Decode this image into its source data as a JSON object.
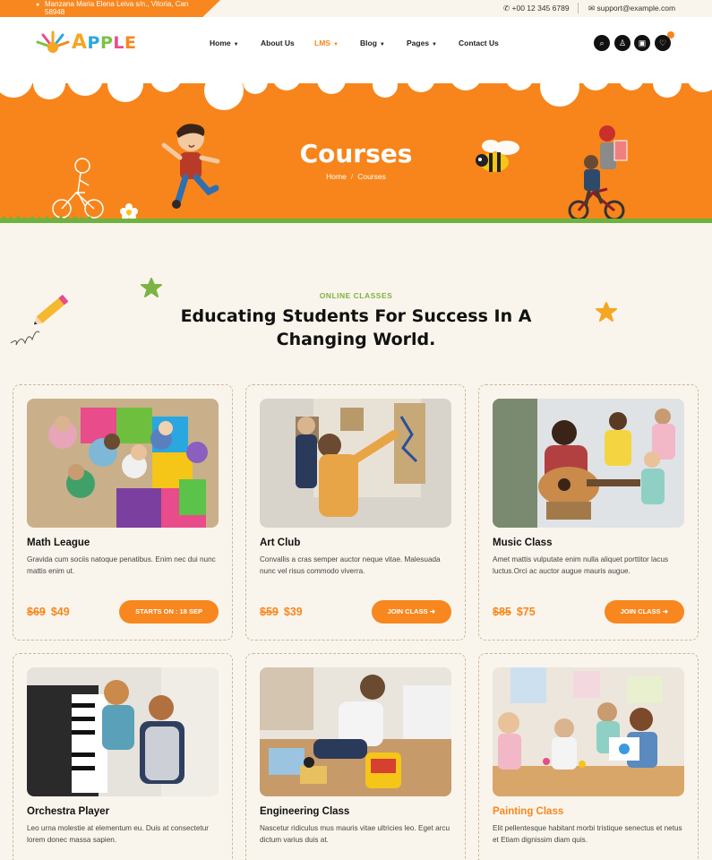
{
  "topbar": {
    "address": "Manzana Maria Elena Leiva s/n., Vitoria, Can 58948",
    "phone": "+00 12 345 6789",
    "email": "support@example.com"
  },
  "logo": {
    "text": "APPLE"
  },
  "nav": {
    "items": [
      {
        "label": "Home",
        "has_dropdown": true,
        "active": false
      },
      {
        "label": "About Us",
        "has_dropdown": false,
        "active": false
      },
      {
        "label": "LMS",
        "has_dropdown": true,
        "active": true
      },
      {
        "label": "Blog",
        "has_dropdown": true,
        "active": false
      },
      {
        "label": "Pages",
        "has_dropdown": true,
        "active": false
      },
      {
        "label": "Contact Us",
        "has_dropdown": false,
        "active": false
      }
    ],
    "icons": [
      "search-icon",
      "user-icon",
      "cart-icon",
      "heart-icon"
    ]
  },
  "hero": {
    "title": "Courses",
    "breadcrumb": [
      "Home",
      "Courses"
    ]
  },
  "section": {
    "kicker": "ONLINE CLASSES",
    "title": "Educating Students For Success In A Changing World."
  },
  "courses": [
    {
      "title": "Math League",
      "description": "Gravida cum sociis natoque penatibus. Enim nec dui nunc mattis enim ut.",
      "old_price": "$69",
      "price": "$49",
      "button": "STARTS ON : 18 SEP"
    },
    {
      "title": "Art Club",
      "description": "Convallis a cras semper auctor neque vitae. Malesuada nunc vel risus commodo viverra.",
      "old_price": "$59",
      "price": "$39",
      "button": "JOIN CLASS"
    },
    {
      "title": "Music Class",
      "description": "Amet mattis vulputate enim nulla aliquet porttitor lacus luctus.Orci ac auctor augue mauris augue.",
      "old_price": "$85",
      "price": "$75",
      "button": "JOIN CLASS"
    },
    {
      "title": "Orchestra Player",
      "description": "Leo urna molestie at elementum eu. Duis at consectetur lorem donec massa sapien.",
      "old_price": "",
      "price": "",
      "button": ""
    },
    {
      "title": "Engineering Class",
      "description": "Nascetur ridiculus mus mauris vitae ultricies leo. Eget arcu dictum varius duis at.",
      "old_price": "",
      "price": "",
      "button": ""
    },
    {
      "title": "Painting Class",
      "description": "Elit pellentesque habitant morbi tristique senectus et netus et Etiam dignissim diam quis.",
      "old_price": "",
      "price": "",
      "button": ""
    }
  ],
  "colors": {
    "accent": "#f7871e",
    "green": "#7cb342",
    "background": "#faf5ec"
  }
}
